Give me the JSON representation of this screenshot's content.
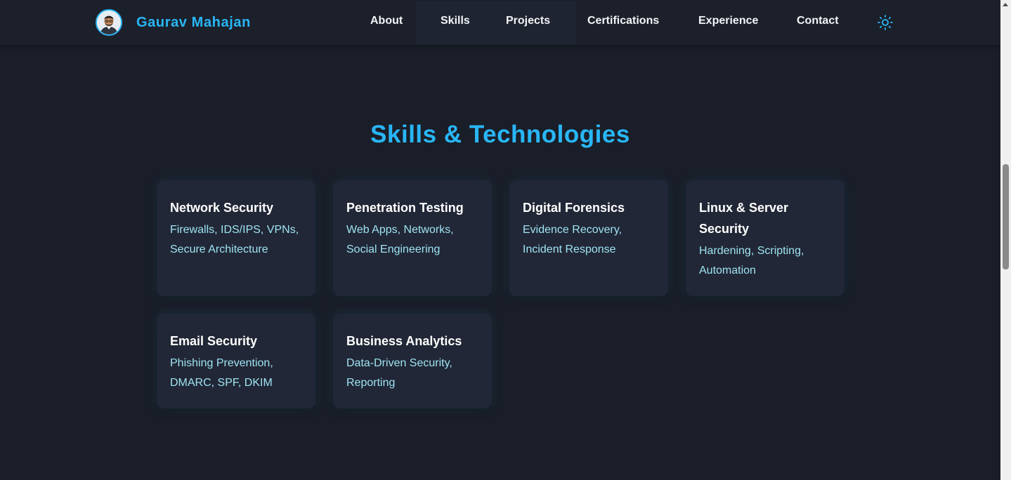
{
  "brand": {
    "name": "Gaurav Mahajan",
    "avatar_icon": "profile-avatar-icon",
    "accent_color": "#29b6f6"
  },
  "nav": {
    "links": [
      {
        "label": "About"
      },
      {
        "label": "Skills"
      },
      {
        "label": "Projects"
      },
      {
        "label": "Certifications"
      },
      {
        "label": "Experience"
      },
      {
        "label": "Contact"
      }
    ],
    "theme_toggle_icon": "sun-icon"
  },
  "skills": {
    "title": "Skills & Technologies",
    "cards": [
      {
        "title": "Network Security",
        "description": "Firewalls, IDS/IPS, VPNs, Secure Architecture"
      },
      {
        "title": "Penetration Testing",
        "description": "Web Apps, Networks, Social Engineering"
      },
      {
        "title": "Digital Forensics",
        "description": "Evidence Recovery, Incident Response"
      },
      {
        "title": "Linux & Server Security",
        "description": "Hardening, Scripting, Automation"
      },
      {
        "title": "Email Security",
        "description": "Phishing Prevention, DMARC, SPF, DKIM"
      },
      {
        "title": "Business Analytics",
        "description": "Data-Driven Security, Reporting"
      }
    ]
  },
  "colors": {
    "background": "#1a1e28",
    "card_background": "#212736",
    "card_title": "#ffffff",
    "card_text": "#9fe3f2",
    "nav_text": "#f2f4f7"
  }
}
